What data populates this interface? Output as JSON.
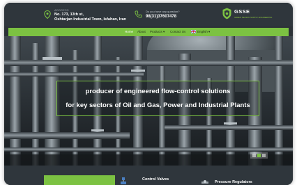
{
  "header": {
    "address_label": "ADDRESS",
    "address_line1": "No. 173, 13th st,",
    "address_line2": "Oshtarjan Industrial Town, Isfahan, Iran",
    "question_label": "Do you have any question?",
    "phone": "98(31)37607478"
  },
  "logo": {
    "name": "GSSE",
    "tagline": "GREEN SEASON SUPPLY ENGINEERING"
  },
  "nav": {
    "items": [
      "Home",
      "About",
      "Products ▾",
      "Contact Us",
      "English ▾"
    ]
  },
  "hero": {
    "line1": "producer of engineered flow-control solutions",
    "line2": "for key sectors of Oil and Gas, Power and Industrial Plants"
  },
  "products": {
    "item1": "Control Valves",
    "item2": "Pressure Regulators"
  },
  "colors": {
    "accent": "#7cc242",
    "header_bg": "#2f363c"
  }
}
